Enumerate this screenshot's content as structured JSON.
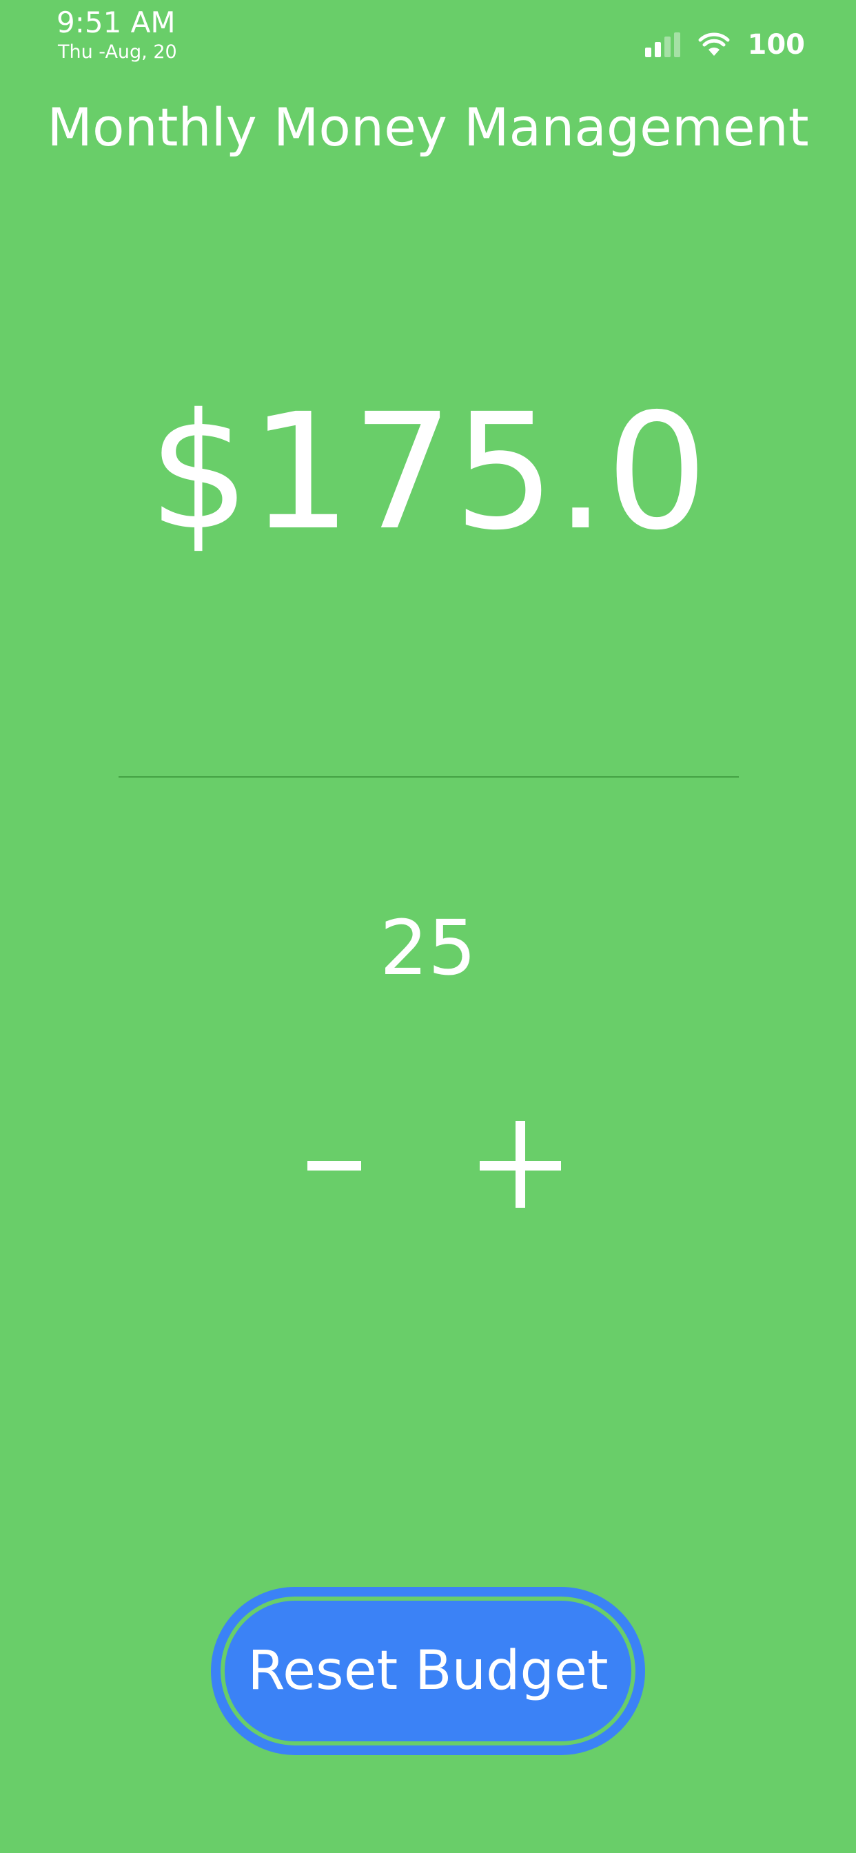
{
  "status_bar": {
    "time": "9:51 AM",
    "date": "Thu -Aug, 20",
    "battery": "100"
  },
  "header": {
    "title": "Monthly Money Management"
  },
  "budget": {
    "amount": "$175.0",
    "step_value": "25"
  },
  "controls": {
    "minus_label": "−",
    "plus_label": "+",
    "reset_label": "Reset Budget"
  },
  "colors": {
    "background": "#69CE69",
    "reset_button": "#3B82F6",
    "text": "#FFFFFF"
  }
}
